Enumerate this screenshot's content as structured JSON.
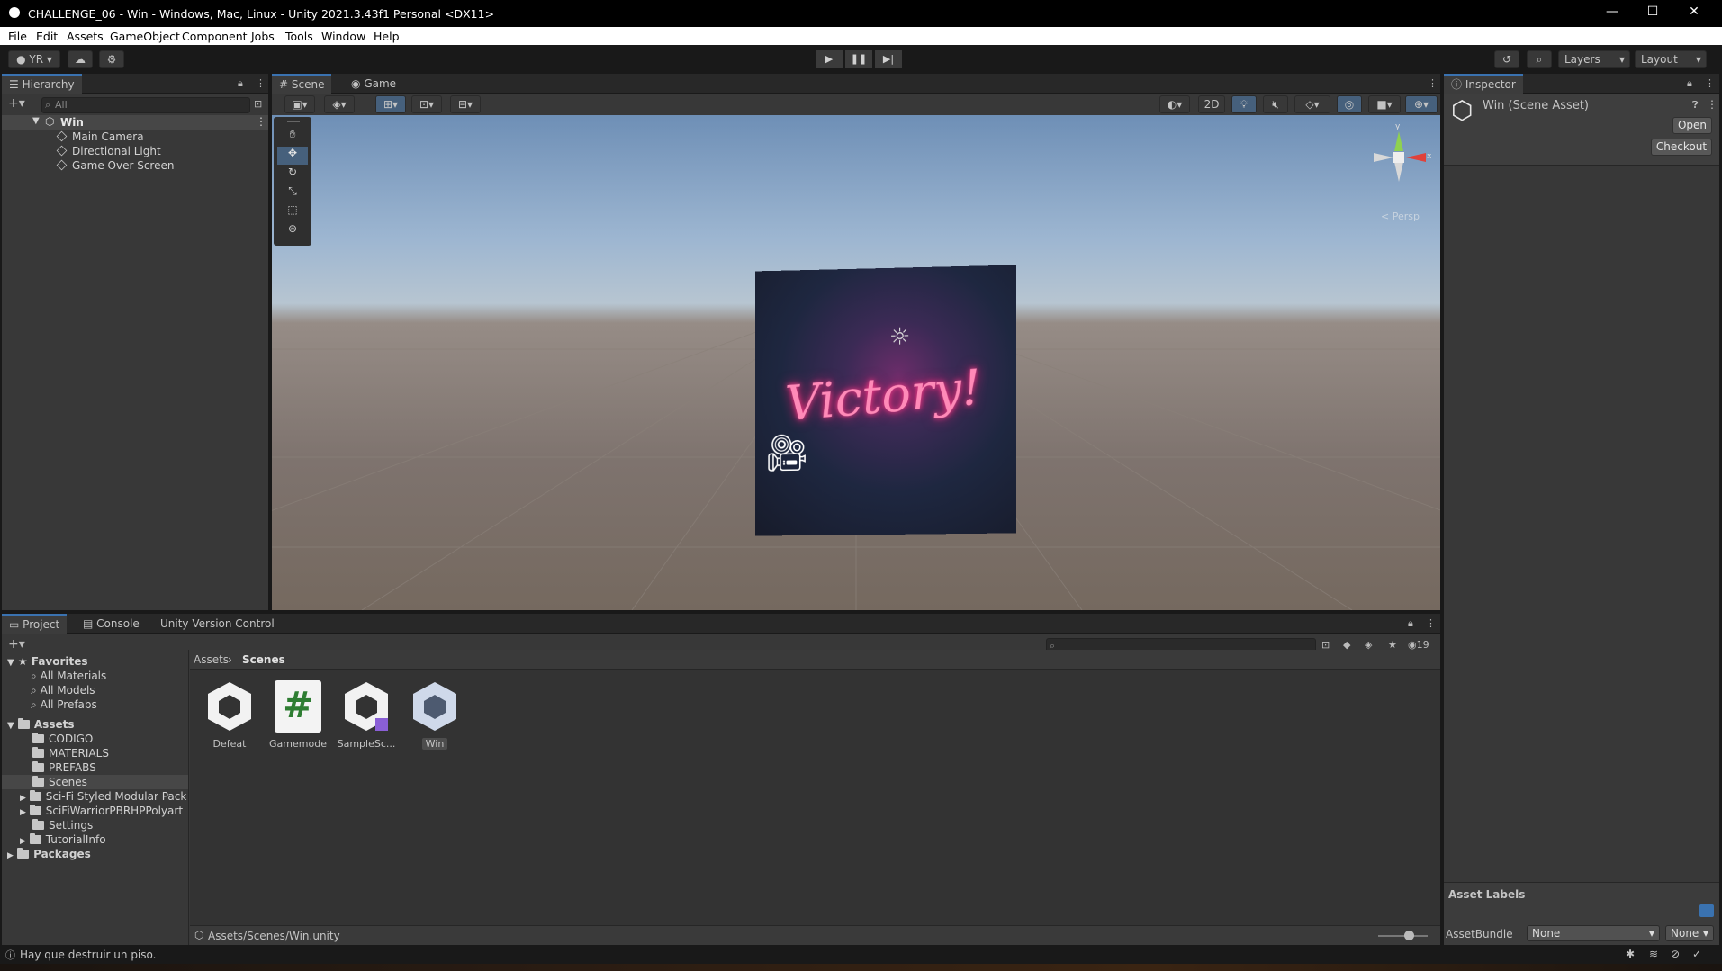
{
  "window": {
    "title": "CHALLENGE_06 - Win - Windows, Mac, Linux - Unity 2021.3.43f1 Personal <DX11>",
    "minimize": "—",
    "maximize": "☐",
    "close": "✕"
  },
  "menu": [
    "File",
    "Edit",
    "Assets",
    "GameObject",
    "Component",
    "Jobs",
    "Tools",
    "Window",
    "Help"
  ],
  "toolbar": {
    "account": "YR",
    "layers_label": "Layers",
    "layout_label": "Layout"
  },
  "hierarchy": {
    "tab": "Hierarchy",
    "search_placeholder": "All",
    "scene": "Win",
    "items": [
      "Main Camera",
      "Directional Light",
      "Game Over Screen"
    ]
  },
  "scene_view": {
    "tabs": [
      "Scene",
      "Game"
    ],
    "btn_2d": "2D",
    "persp_label": "< Persp",
    "axis_x": "x",
    "axis_y": "y",
    "victory_text": "Victory!"
  },
  "inspector": {
    "tab": "Inspector",
    "asset_title": "Win (Scene Asset)",
    "open_button": "Open",
    "checkout_button": "Checkout",
    "asset_labels": "Asset Labels",
    "assetbundle_label": "AssetBundle",
    "assetbundle_value": "None",
    "assetbundle_variant": "None"
  },
  "project": {
    "tabs": [
      "Project",
      "Console",
      "Unity Version Control"
    ],
    "hidden_count": "19",
    "favorites_label": "Favorites",
    "favorites": [
      "All Materials",
      "All Models",
      "All Prefabs"
    ],
    "assets_label": "Assets",
    "folders": [
      "CODIGO",
      "MATERIALS",
      "PREFABS",
      "Scenes",
      "Sci-Fi Styled Modular Pack",
      "SciFiWarriorPBRHPPolyart",
      "Settings",
      "TutorialInfo"
    ],
    "packages_label": "Packages",
    "breadcrumb": [
      "Assets",
      "Scenes"
    ],
    "files": [
      "Defeat",
      "Gamemode",
      "SampleSc...",
      "Win"
    ],
    "gamemode_symbol": "#",
    "path": "Assets/Scenes/Win.unity"
  },
  "status": {
    "message": "Hay que destruir un piso."
  }
}
